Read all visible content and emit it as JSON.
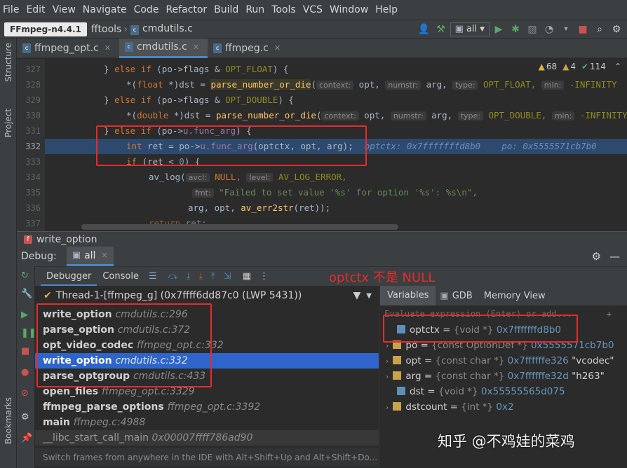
{
  "menu": [
    "File",
    "Edit",
    "View",
    "Navigate",
    "Code",
    "Refactor",
    "Build",
    "Run",
    "Tools",
    "VCS",
    "Window",
    "Help"
  ],
  "nav": {
    "project": "FFmpeg-n4.4.1",
    "crumb1": "fftools",
    "crumb2": "cmdutils.c",
    "config": "all"
  },
  "stripe": {
    "structure": "Structure",
    "project": "Project",
    "bookmarks": "Bookmarks"
  },
  "tabs": [
    {
      "label": "ffmpeg_opt.c"
    },
    {
      "label": "cmdutils.c"
    },
    {
      "label": "ffmpeg.c"
    }
  ],
  "inspections": {
    "warnings": "68",
    "weak": "4",
    "typos": "114"
  },
  "line_numbers": [
    "327",
    "328",
    "329",
    "330",
    "331",
    "332",
    "333",
    "334",
    "335",
    "336",
    "337"
  ],
  "code": {
    "l327a": "} ",
    "l327b": "else if",
    "l327c": " (po->flags & ",
    "l327d": "OPT_FLOAT",
    "l327e": ") {",
    "l328a": "*(",
    "l328b": "float",
    "l328c": " *)dst = ",
    "l328d": "parse_number_or_die",
    "l328e": "(",
    "l328h1": "context:",
    "l328f": " opt, ",
    "l328h2": "numstr:",
    "l328g": " arg, ",
    "l328h3": "type:",
    "l328i": " OPT_FLOAT, ",
    "l328h4": "min:",
    "l328j": " -INFINITY",
    "l329a": "} ",
    "l329b": "else if",
    "l329c": " (po->flags & ",
    "l329d": "OPT_DOUBLE",
    "l329e": ") {",
    "l330a": "*(",
    "l330b": "double",
    "l330c": " *)dst = ",
    "l330d": "parse_number_or_die",
    "l330e": "(",
    "l330h1": "context:",
    "l330f": " opt, ",
    "l330h2": "numstr:",
    "l330g": " arg, ",
    "l330h3": "type:",
    "l330i": " OPT_DOUBLE, ",
    "l330h4": "min:",
    "l330j": " -INFINITY",
    "l331a": "} ",
    "l331b": "else if",
    "l331c": " (po->",
    "l331d": "u.func_arg",
    "l331e": ") {",
    "l332a": "int",
    "l332b": " ret = po->",
    "l332c": "u.func_arg",
    "l332d": "(optctx, opt, arg);",
    "l332e": "optctx: 0x7fffffffd8b0",
    "l332f": "po: 0x5555571cb7b0",
    "l333a": "if",
    "l333b": " (ret < ",
    "l333c": "0",
    "l333d": ") {",
    "l334a": "av_log(",
    "l334h1": "avcl:",
    "l334b": " NULL, ",
    "l334h2": "level:",
    "l334c": " AV_LOG_ERROR,",
    "l335h": "fmt:",
    "l335a": " \"Failed to set value '%s' for option '%s': %s\\n\",",
    "l336a": "arg, opt, ",
    "l336b": "av_err2str",
    "l336c": "(ret));",
    "l337a": "return",
    "l337b": " ret;"
  },
  "debug": {
    "func_title": "write_option",
    "label": "Debug:",
    "config_tab": "all",
    "tabs": {
      "debugger": "Debugger",
      "console": "Console",
      "variables": "Variables",
      "gdb": "GDB",
      "memory": "Memory View"
    },
    "thread": "Thread-1-[ffmpeg_g] (0x7ffff6dd87c0 (LWP 5431))",
    "annotation": "optctx 不是 NULL",
    "evaluate_placeholder": "Evaluate expression (Enter) or add...",
    "frames": [
      {
        "fn": "write_option",
        "loc": "cmdutils.c:296"
      },
      {
        "fn": "parse_option",
        "loc": "cmdutils.c:372"
      },
      {
        "fn": "opt_video_codec",
        "loc": "ffmpeg_opt.c:332"
      },
      {
        "fn": "write_option",
        "loc": "cmdutils.c:332"
      },
      {
        "fn": "parse_optgroup",
        "loc": "cmdutils.c:433"
      },
      {
        "fn": "open_files",
        "loc": "ffmpeg_opt.c:3329"
      },
      {
        "fn": "ffmpeg_parse_options",
        "loc": "ffmpeg_opt.c:3392"
      },
      {
        "fn": "main",
        "loc": "ffmpeg.c:4988"
      },
      {
        "fn": "__libc_start_call_main",
        "loc": "0x00007ffff786ad90"
      }
    ],
    "status": "Switch frames from anywhere in the IDE with Alt+Shift+Up and Alt+Shift+Do...",
    "variables": [
      {
        "name": "optctx",
        "type": "{void *}",
        "value": "0x7fffffffd8b0",
        "extra": ""
      },
      {
        "name": "po",
        "type": "{const OptionDef *}",
        "value": "0x5555571cb7b0",
        "extra": ""
      },
      {
        "name": "opt",
        "type": "{const char *}",
        "value": "0x7ffffffe326",
        "extra": "\"vcodec\""
      },
      {
        "name": "arg",
        "type": "{const char *}",
        "value": "0x7ffffffe32d",
        "extra": "\"h263\""
      },
      {
        "name": "dst",
        "type": "{void *}",
        "value": "0x55555565d075",
        "extra": ""
      },
      {
        "name": "dstcount",
        "type": "{int *}",
        "value": "0x2",
        "extra": ""
      }
    ]
  },
  "watermark": "知乎 @不鸡娃的菜鸡",
  "colors": {
    "selected": "#2f65ca",
    "annotation": "#e52b2b",
    "accent": "#4a88c7"
  }
}
